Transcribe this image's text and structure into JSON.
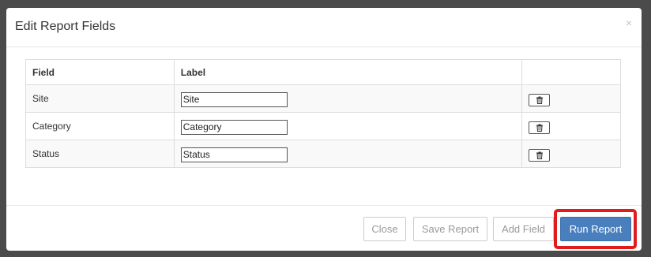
{
  "dialog": {
    "title": "Edit Report Fields",
    "close_glyph": "×"
  },
  "table": {
    "headers": {
      "field": "Field",
      "label": "Label",
      "action": ""
    },
    "rows": [
      {
        "field": "Site",
        "label_value": "Site",
        "delete_icon": "trash-icon"
      },
      {
        "field": "Category",
        "label_value": "Category",
        "delete_icon": "trash-icon"
      },
      {
        "field": "Status",
        "label_value": "Status",
        "delete_icon": "trash-icon"
      }
    ]
  },
  "footer": {
    "close_label": "Close",
    "save_label": "Save Report",
    "add_label": "Add Field",
    "run_label": "Run Report"
  },
  "colors": {
    "primary": "#4a7fbd",
    "highlight": "#e01c1c",
    "backdrop": "#4b4b4b"
  }
}
